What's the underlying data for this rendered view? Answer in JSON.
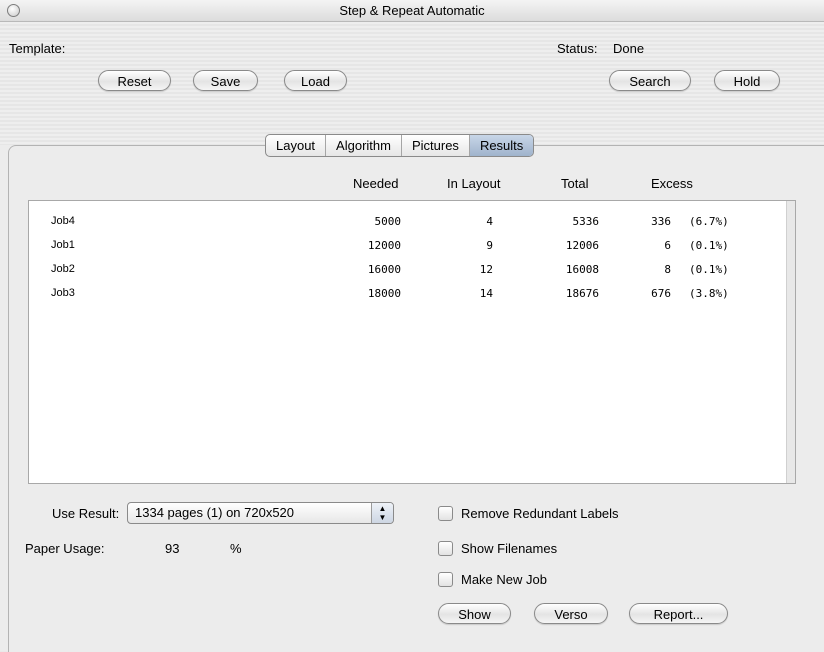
{
  "window": {
    "title": "Step & Repeat Automatic"
  },
  "header": {
    "template_label": "Template:",
    "status_label": "Status:",
    "status_value": "Done",
    "buttons": {
      "reset": "Reset",
      "save": "Save",
      "load": "Load",
      "search": "Search",
      "hold": "Hold"
    }
  },
  "tabs": [
    {
      "label": "Layout",
      "active": false
    },
    {
      "label": "Algorithm",
      "active": false
    },
    {
      "label": "Pictures",
      "active": false
    },
    {
      "label": "Results",
      "active": true
    }
  ],
  "results": {
    "columns": [
      "Needed",
      "In Layout",
      "Total",
      "Excess"
    ],
    "rows": [
      {
        "job": "Job4",
        "needed": "5000",
        "in_layout": "4",
        "total": "5336",
        "excess": "336",
        "excess_pct": "(6.7%)"
      },
      {
        "job": "Job1",
        "needed": "12000",
        "in_layout": "9",
        "total": "12006",
        "excess": "6",
        "excess_pct": "(0.1%)"
      },
      {
        "job": "Job2",
        "needed": "16000",
        "in_layout": "12",
        "total": "16008",
        "excess": "8",
        "excess_pct": "(0.1%)"
      },
      {
        "job": "Job3",
        "needed": "18000",
        "in_layout": "14",
        "total": "18676",
        "excess": "676",
        "excess_pct": "(3.8%)"
      }
    ]
  },
  "footer": {
    "use_result_label": "Use Result:",
    "use_result_value": "1334 pages (1) on 720x520",
    "paper_usage_label": "Paper Usage:",
    "paper_usage_value": "93",
    "paper_usage_unit": "%",
    "checkboxes": [
      {
        "label": "Remove Redundant Labels",
        "checked": false
      },
      {
        "label": "Show Filenames",
        "checked": false
      },
      {
        "label": "Make New Job",
        "checked": false
      }
    ],
    "buttons": {
      "show": "Show",
      "verso": "Verso",
      "report": "Report..."
    }
  }
}
